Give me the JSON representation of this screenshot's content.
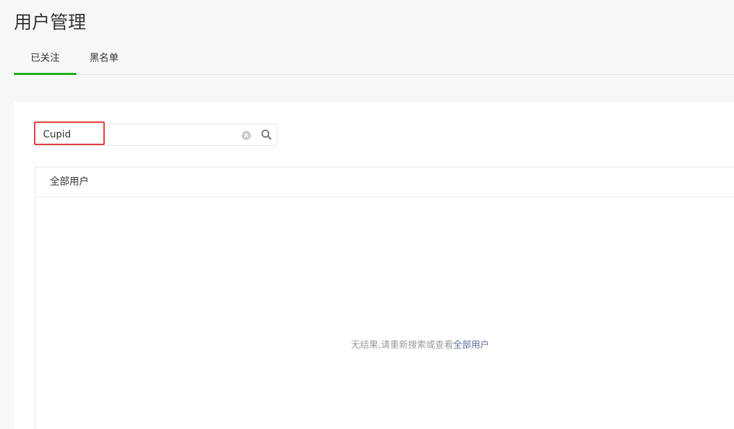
{
  "page": {
    "title": "用户管理"
  },
  "tabs": [
    {
      "label": "已关注",
      "active": true
    },
    {
      "label": "黑名单",
      "active": false
    }
  ],
  "search": {
    "value": "Cupid",
    "placeholder": ""
  },
  "panel": {
    "header": "全部用户",
    "empty_text": "无结果,请重新搜索或查看",
    "empty_link": "全部用户"
  },
  "colors": {
    "accent": "#1aad19",
    "highlight": "#e53935",
    "link": "#576b95"
  },
  "icons": {
    "clear": "clear-icon",
    "search": "search-icon"
  }
}
